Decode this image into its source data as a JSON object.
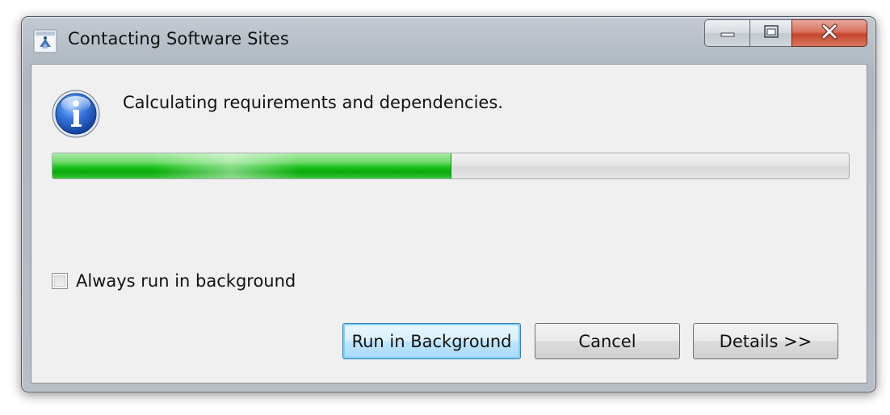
{
  "window": {
    "title": "Contacting Software Sites",
    "app_icon": "eclipse-installer-icon",
    "caption_buttons": {
      "minimize_icon": "minimize-icon",
      "maximize_icon": "maximize-icon",
      "close_icon": "close-icon"
    }
  },
  "dialog": {
    "status_icon": "info-icon",
    "message": "Calculating requirements and dependencies.",
    "progress": {
      "fraction": 0.5,
      "color": "#14b814"
    },
    "checkbox": {
      "label": "Always run in background",
      "checked": false
    },
    "buttons": {
      "run_in_background": "Run in Background",
      "cancel": "Cancel",
      "details": "Details >>"
    }
  }
}
